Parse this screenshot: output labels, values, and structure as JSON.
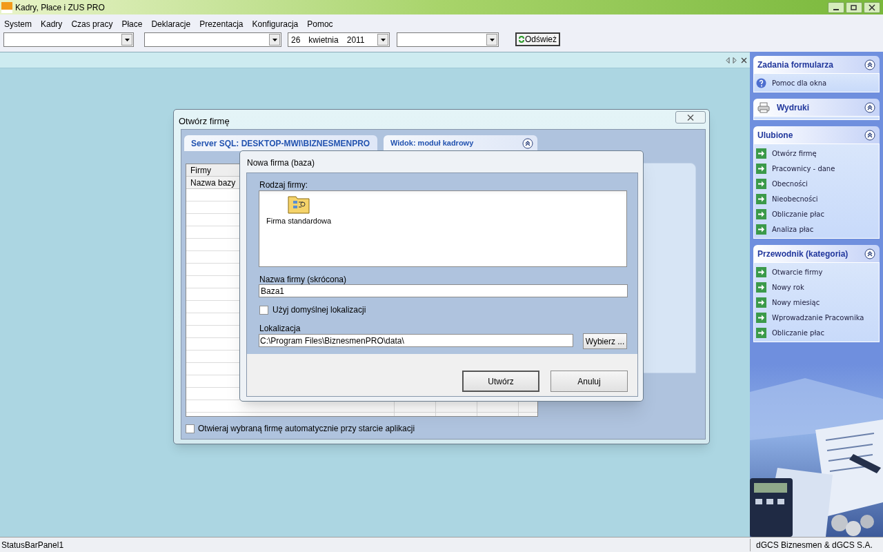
{
  "window": {
    "title": "Kadry, Płace i ZUS PRO"
  },
  "menu": [
    "System",
    "Kadry",
    "Czas pracy",
    "Płace",
    "Deklaracje",
    "Prezentacja",
    "Konfiguracja",
    "Pomoc"
  ],
  "toolbar": {
    "date": {
      "day": "26",
      "month": "kwietnia",
      "year": "2011"
    },
    "refresh": "Odśwież"
  },
  "open_dialog": {
    "title": "Otwórz firmę",
    "server_pane": "Server SQL: DESKTOP-MWI\\BIZNESMENPRO",
    "view_pane": "Widok: moduł kadrowy",
    "grid_group": "Firmy",
    "grid_column": "Nazwa bazy",
    "auto_open": {
      "label": "Otwieraj wybraną firmę automatycznie przy starcie aplikacji",
      "checked": false
    }
  },
  "new_dialog": {
    "title": "Nowa firma (baza)",
    "type_label": "Rodzaj firmy:",
    "types": [
      {
        "label": "Firma standardowa"
      }
    ],
    "name_label": "Nazwa firmy (skrócona)",
    "name_value": "Baza1",
    "default_location": {
      "label": "Użyj domyślnej lokalizacji",
      "checked": false
    },
    "location_label": "Lokalizacja",
    "location_value": "C:\\Program Files\\BiznesmenPRO\\data\\",
    "browse": "Wybierz ...",
    "buttons": [
      "Utwórz",
      "Anuluj"
    ]
  },
  "task_panes": [
    {
      "title": "Zadania formularza",
      "kind": "plain",
      "items": [
        {
          "label": "Pomoc dla okna",
          "kind": "help"
        }
      ]
    },
    {
      "title": "Wydruki",
      "kind": "printer"
    },
    {
      "title": "Ulubione",
      "kind": "plain",
      "items": [
        {
          "label": "Otwórz firmę",
          "kind": "link"
        },
        {
          "label": "Pracownicy - dane",
          "kind": "link"
        },
        {
          "label": "Obecności",
          "kind": "link"
        },
        {
          "label": "Nieobecności",
          "kind": "link"
        },
        {
          "label": "Obliczanie płac",
          "kind": "link"
        },
        {
          "label": "Analiza płac",
          "kind": "link"
        }
      ]
    },
    {
      "title": "Przewodnik (kategoria)",
      "kind": "plain",
      "items": [
        {
          "label": "Otwarcie firmy",
          "kind": "link"
        },
        {
          "label": "Nowy rok",
          "kind": "link"
        },
        {
          "label": "Nowy miesiąc",
          "kind": "link"
        },
        {
          "label": "Wprowadzanie Pracownika",
          "kind": "link"
        },
        {
          "label": "Obliczanie płac",
          "kind": "link"
        }
      ]
    }
  ],
  "status_bar": {
    "left": "StatusBarPanel1",
    "right": "dGCS Biznesmen & dGCS S.A."
  }
}
